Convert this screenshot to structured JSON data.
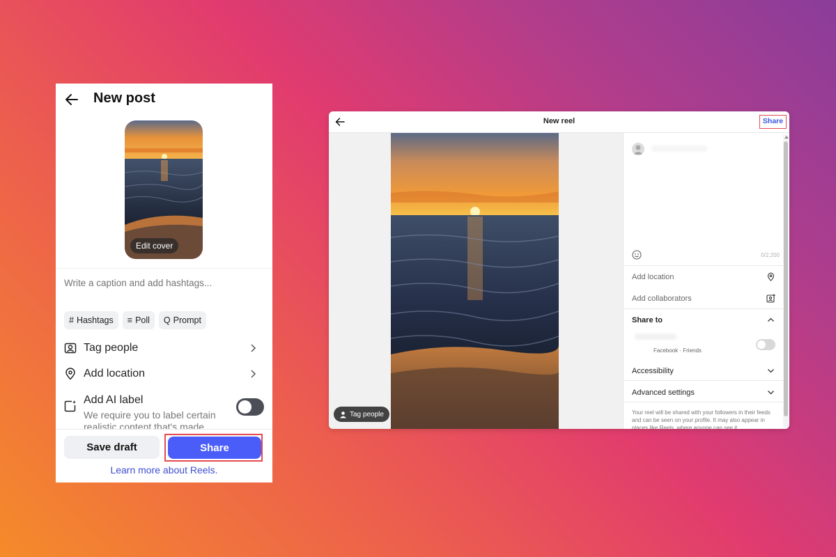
{
  "mobile": {
    "title": "New post",
    "back_icon": "arrow-left-icon",
    "edit_cover_label": "Edit cover",
    "caption_placeholder": "Write a caption and add hashtags...",
    "chips": [
      {
        "icon": "#",
        "label": "Hashtags"
      },
      {
        "icon": "≡",
        "label": "Poll"
      },
      {
        "icon": "Q",
        "label": "Prompt"
      }
    ],
    "tag_people_label": "Tag people",
    "add_location_label": "Add location",
    "ai_label": {
      "title": "Add AI label",
      "description": "We require you to label certain realistic content that's made"
    },
    "save_draft_label": "Save draft",
    "share_label": "Share",
    "learn_more_label": "Learn more about Reels.",
    "colors": {
      "share_button": "#4a5df9",
      "highlight": "#e54952",
      "link": "#3e4fd0"
    }
  },
  "desktop": {
    "title": "New reel",
    "share_label": "Share",
    "tag_people_label": "Tag people",
    "char_count": "0/2,200",
    "add_location_label": "Add location",
    "add_collaborators_label": "Add collaborators",
    "share_to_label": "Share to",
    "facebook_subtitle": "Facebook · Friends",
    "accessibility_label": "Accessibility",
    "advanced_settings_label": "Advanced settings",
    "note": "Your reel will be shared with your followers in their feeds and can be seen on your profile. It may also appear in places like Reels, where anyone can see it.",
    "colors": {
      "share_link": "#3b58e0",
      "highlight": "#e04a53"
    }
  }
}
